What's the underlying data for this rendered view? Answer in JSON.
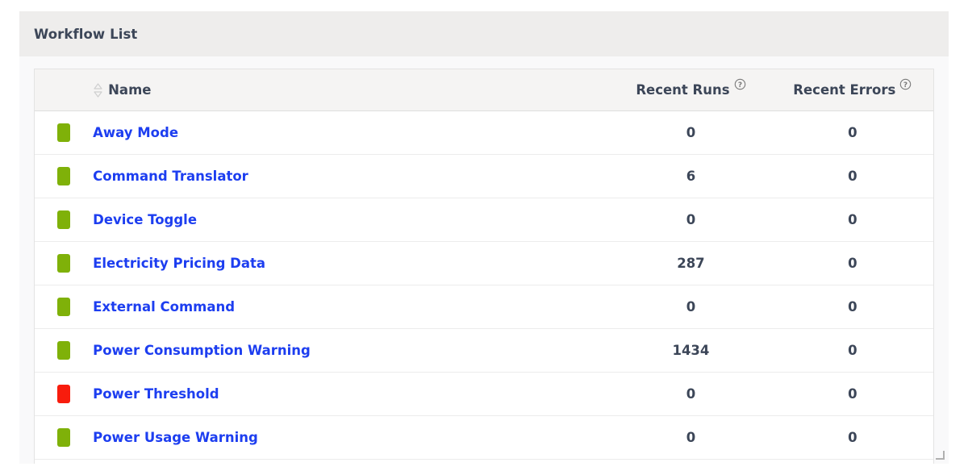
{
  "panel": {
    "title": "Workflow List",
    "resize_handle_icon": "resize-corner-icon"
  },
  "table": {
    "columns": [
      {
        "key": "status",
        "label": "",
        "icon": ""
      },
      {
        "key": "name",
        "label": "Name",
        "icon": "sort-updown-icon"
      },
      {
        "key": "recent_runs",
        "label": "Recent Runs",
        "icon": "help-circle-icon"
      },
      {
        "key": "recent_errors",
        "label": "Recent Errors",
        "icon": "help-circle-icon"
      }
    ],
    "rows": [
      {
        "status": "green",
        "name": "Away Mode",
        "recent_runs": "0",
        "recent_errors": "0"
      },
      {
        "status": "green",
        "name": "Command Translator",
        "recent_runs": "6",
        "recent_errors": "0"
      },
      {
        "status": "green",
        "name": "Device Toggle",
        "recent_runs": "0",
        "recent_errors": "0"
      },
      {
        "status": "green",
        "name": "Electricity Pricing Data",
        "recent_runs": "287",
        "recent_errors": "0"
      },
      {
        "status": "green",
        "name": "External Command",
        "recent_runs": "0",
        "recent_errors": "0"
      },
      {
        "status": "green",
        "name": "Power Consumption Warning",
        "recent_runs": "1434",
        "recent_errors": "0"
      },
      {
        "status": "red",
        "name": "Power Threshold",
        "recent_runs": "0",
        "recent_errors": "0"
      },
      {
        "status": "green",
        "name": "Power Usage Warning",
        "recent_runs": "0",
        "recent_errors": "0"
      }
    ]
  },
  "colors": {
    "status_green": "#7fb109",
    "status_red": "#f81c0d",
    "link_blue": "#1d3ef0",
    "text_dark": "#3c4658",
    "titlebar_bg": "#eeedec",
    "table_header_bg": "#f5f4f3",
    "panel_bg": "#f9f9fa"
  }
}
